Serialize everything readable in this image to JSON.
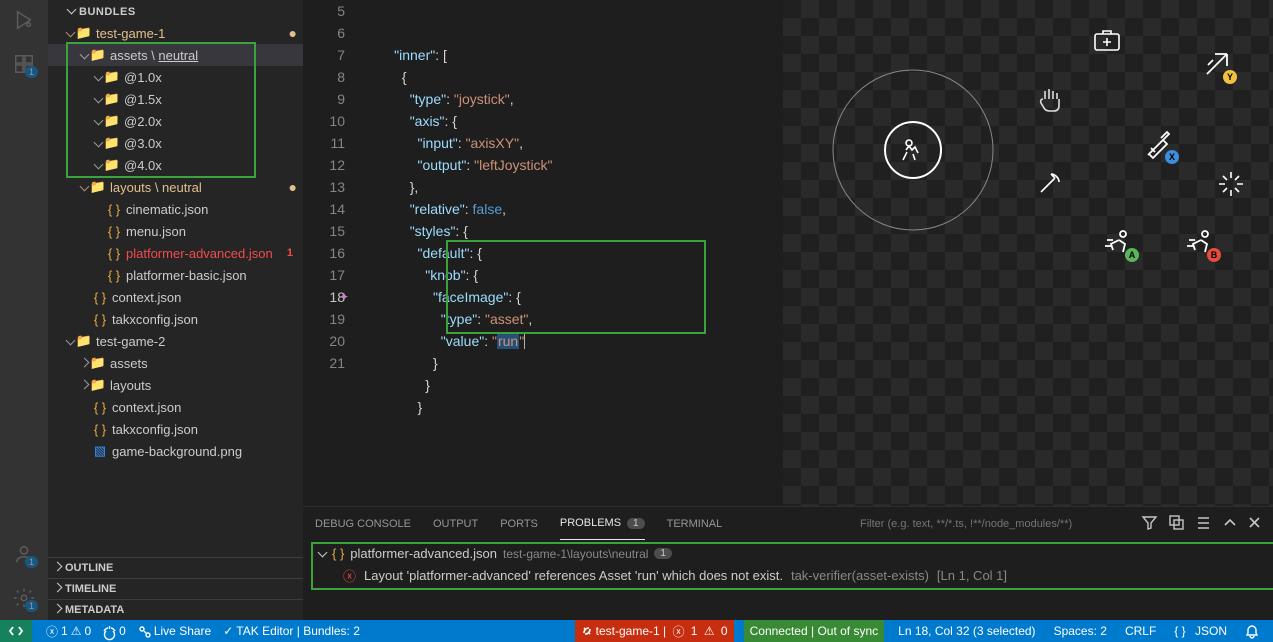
{
  "sidebar": {
    "title": "BUNDLES",
    "tree": {
      "game1": "test-game-1",
      "assets_label": "assets",
      "assets_path": "neutral",
      "scales": [
        "@1.0x",
        "@1.5x",
        "@2.0x",
        "@3.0x",
        "@4.0x"
      ],
      "layouts_label": "layouts",
      "layouts_path": "neutral",
      "layout_files": {
        "cinematic": "cinematic.json",
        "menu": "menu.json",
        "platformer_adv": "platformer-advanced.json",
        "platformer_basic": "platformer-basic.json"
      },
      "context1": "context.json",
      "takx1": "takxconfig.json",
      "game2": "test-game-2",
      "g2_assets": "assets",
      "g2_layouts": "layouts",
      "g2_context": "context.json",
      "g2_takx": "takxconfig.json",
      "bg_img": "game-background.png"
    },
    "sections": {
      "outline": "OUTLINE",
      "timeline": "TIMELINE",
      "metadata": "METADATA"
    }
  },
  "editor": {
    "lines": {
      "5": {
        "indent": 4,
        "content": [
          [
            "key",
            "\"inner\""
          ],
          [
            "pun",
            ": ["
          ]
        ]
      },
      "6": {
        "indent": 5,
        "content": [
          [
            "pun",
            "{"
          ]
        ]
      },
      "7": {
        "indent": 6,
        "content": [
          [
            "key",
            "\"type\""
          ],
          [
            "pun",
            ": "
          ],
          [
            "str",
            "\"joystick\""
          ],
          [
            "pun",
            ","
          ]
        ]
      },
      "8": {
        "indent": 6,
        "content": [
          [
            "key",
            "\"axis\""
          ],
          [
            "pun",
            ": {"
          ]
        ]
      },
      "9": {
        "indent": 7,
        "content": [
          [
            "key",
            "\"input\""
          ],
          [
            "pun",
            ": "
          ],
          [
            "str",
            "\"axisXY\""
          ],
          [
            "pun",
            ","
          ]
        ]
      },
      "10": {
        "indent": 7,
        "content": [
          [
            "key",
            "\"output\""
          ],
          [
            "pun",
            ": "
          ],
          [
            "str",
            "\"leftJoystick\""
          ]
        ]
      },
      "11": {
        "indent": 6,
        "content": [
          [
            "pun",
            "},"
          ]
        ]
      },
      "12": {
        "indent": 6,
        "content": [
          [
            "key",
            "\"relative\""
          ],
          [
            "pun",
            ": "
          ],
          [
            "bool",
            "false"
          ],
          [
            "pun",
            ","
          ]
        ]
      },
      "13": {
        "indent": 6,
        "content": [
          [
            "key",
            "\"styles\""
          ],
          [
            "pun",
            ": {"
          ]
        ]
      },
      "14": {
        "indent": 7,
        "content": [
          [
            "key",
            "\"default\""
          ],
          [
            "pun",
            ": {"
          ]
        ]
      },
      "15": {
        "indent": 8,
        "content": [
          [
            "key",
            "\"knob\""
          ],
          [
            "pun",
            ": {"
          ]
        ]
      },
      "16": {
        "indent": 9,
        "content": [
          [
            "key",
            "\"faceImage\""
          ],
          [
            "pun",
            ": {"
          ]
        ]
      },
      "17": {
        "indent": 10,
        "content": [
          [
            "key",
            "\"type\""
          ],
          [
            "pun",
            ": "
          ],
          [
            "str",
            "\"asset\""
          ],
          [
            "pun",
            ","
          ]
        ]
      },
      "18": {
        "indent": 10,
        "content": [
          [
            "key",
            "\"value\""
          ],
          [
            "pun",
            ": "
          ],
          [
            "str_pre",
            "\""
          ],
          [
            "sel",
            "run"
          ],
          [
            "str_post",
            "\""
          ]
        ]
      },
      "19": {
        "indent": 9,
        "content": [
          [
            "pun",
            "}"
          ]
        ]
      },
      "20": {
        "indent": 8,
        "content": [
          [
            "pun",
            "}"
          ]
        ]
      },
      "21": {
        "indent": 7,
        "content": [
          [
            "pun",
            "}"
          ]
        ]
      }
    },
    "current_line": 18
  },
  "panel": {
    "tabs": {
      "debug": "DEBUG CONSOLE",
      "output": "OUTPUT",
      "ports": "PORTS",
      "problems": "PROBLEMS",
      "terminal": "TERMINAL"
    },
    "problems_count": "1",
    "filter_placeholder": "Filter (e.g. text, **/*.ts, !**/node_modules/**)",
    "problem": {
      "file": "platformer-advanced.json",
      "path": "test-game-1\\layouts\\neutral",
      "count": "1",
      "message": "Layout 'platformer-advanced' references Asset 'run' which does not exist.",
      "source": "tak-verifier(asset-exists)",
      "location": "[Ln 1, Col 1]"
    }
  },
  "statusbar": {
    "errors": "1",
    "warnings": "0",
    "ports": "0",
    "liveshare": "Live Share",
    "tak_editor": "TAK Editor | Bundles: 2",
    "bundle": "test-game-1 |",
    "bundle_err": "1",
    "bundle_warn": "0",
    "conn": "Connected | Out of sync",
    "cursor": "Ln 18, Col 32 (3 selected)",
    "spaces": "Spaces: 2",
    "eol": "CRLF",
    "lang": "JSON",
    "bell": ""
  }
}
